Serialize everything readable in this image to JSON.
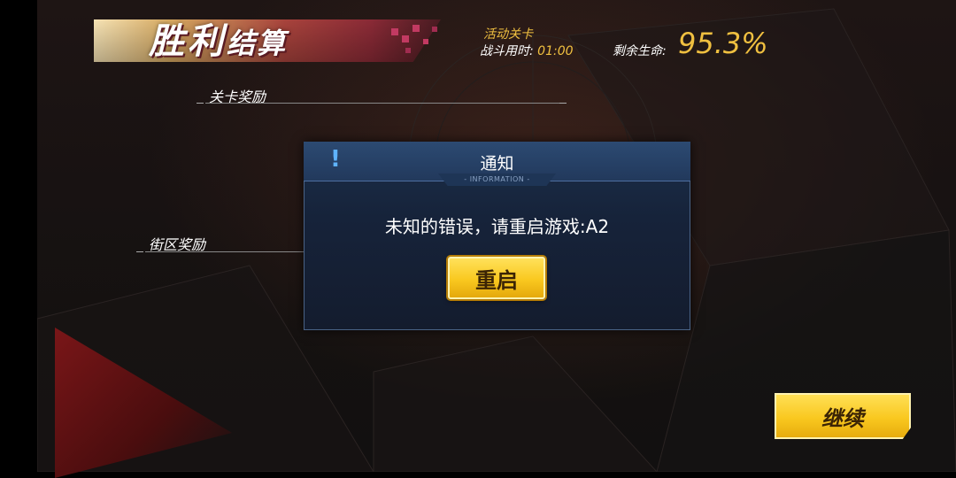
{
  "banner": {
    "title_main": "胜利",
    "title_sub": "结算"
  },
  "stats": {
    "stage_name": "活动关卡",
    "battle_time_label": "战斗用时:",
    "battle_time_value": "01:00",
    "remaining_life_label": "剩余生命:",
    "remaining_life_value": "95.3%"
  },
  "sections": {
    "stage_rewards": "关卡奖励",
    "district_rewards": "街区奖励"
  },
  "dialog": {
    "title": "通知",
    "subtitle": "- INFORMATION -",
    "message": "未知的错误，请重启游戏:A2",
    "restart_label": "重启"
  },
  "continue_label": "继续",
  "colors": {
    "gold": "#f0c040",
    "button_yellow": "#f9c81f",
    "dialog_blue": "#1c2f4a",
    "accent_red": "#8a2a36"
  }
}
